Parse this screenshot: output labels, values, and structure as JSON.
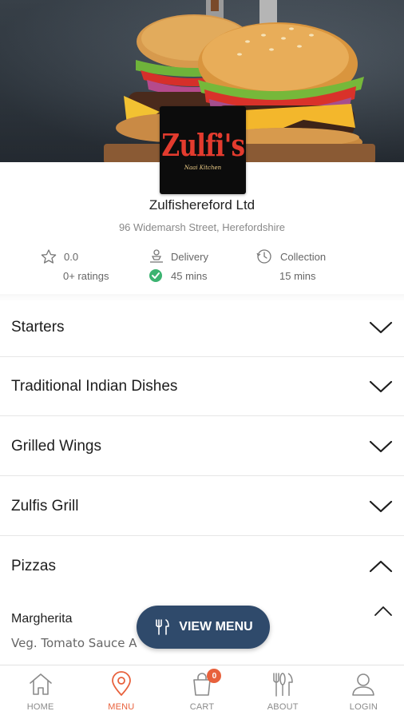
{
  "restaurant": {
    "logo_text": "Zulfi's",
    "logo_sub": "Naai Kitchen",
    "name": "Zulfishereford Ltd",
    "address": "96 Widemarsh Street, Herefordshire"
  },
  "stats": {
    "rating": "0.0",
    "ratings_count": "0+ ratings",
    "delivery_label": "Delivery",
    "delivery_time": "45 mins",
    "collection_label": "Collection",
    "collection_time": "15 mins"
  },
  "categories": [
    {
      "label": "Starters",
      "expanded": false
    },
    {
      "label": "Traditional Indian Dishes",
      "expanded": false
    },
    {
      "label": "Grilled Wings",
      "expanded": false
    },
    {
      "label": "Zulfis Grill",
      "expanded": false
    },
    {
      "label": "Pizzas",
      "expanded": true
    }
  ],
  "item": {
    "name": "Margherita",
    "description": "Veg. Tomato Sauce A"
  },
  "view_menu_label": "VIEW MENU",
  "tabs": [
    {
      "label": "HOME",
      "icon": "home-icon"
    },
    {
      "label": "MENU",
      "icon": "location-pin-icon",
      "active": true
    },
    {
      "label": "CART",
      "icon": "shopping-bag-icon",
      "badge": "0"
    },
    {
      "label": "ABOUT",
      "icon": "cutlery-icon"
    },
    {
      "label": "LOGIN",
      "icon": "user-icon"
    }
  ],
  "colors": {
    "accent": "#e8613c",
    "button": "#2f4a6b",
    "success": "#3cb371"
  }
}
